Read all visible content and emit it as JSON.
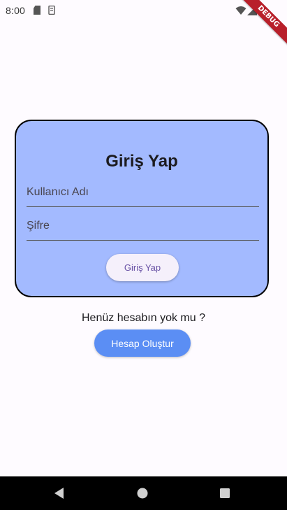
{
  "status_bar": {
    "time": "8:00",
    "icons": [
      "sd-card-icon",
      "usb-icon",
      "wifi-icon",
      "signal-icon"
    ]
  },
  "debug_banner": {
    "label": "DEBUG",
    "color": "#b81f2a"
  },
  "login_card": {
    "title": "Giriş Yap",
    "username_placeholder": "Kullanıcı Adı",
    "password_placeholder": "Şifre",
    "submit_label": "Giriş Yap",
    "background_color": "#a3baff"
  },
  "signup": {
    "prompt": "Henüz hesabın yok mu ?",
    "button_label": "Hesap Oluştur",
    "button_color": "#5b8ef4"
  },
  "nav_bar": {
    "buttons": [
      "back-icon",
      "home-icon",
      "recents-icon"
    ]
  }
}
